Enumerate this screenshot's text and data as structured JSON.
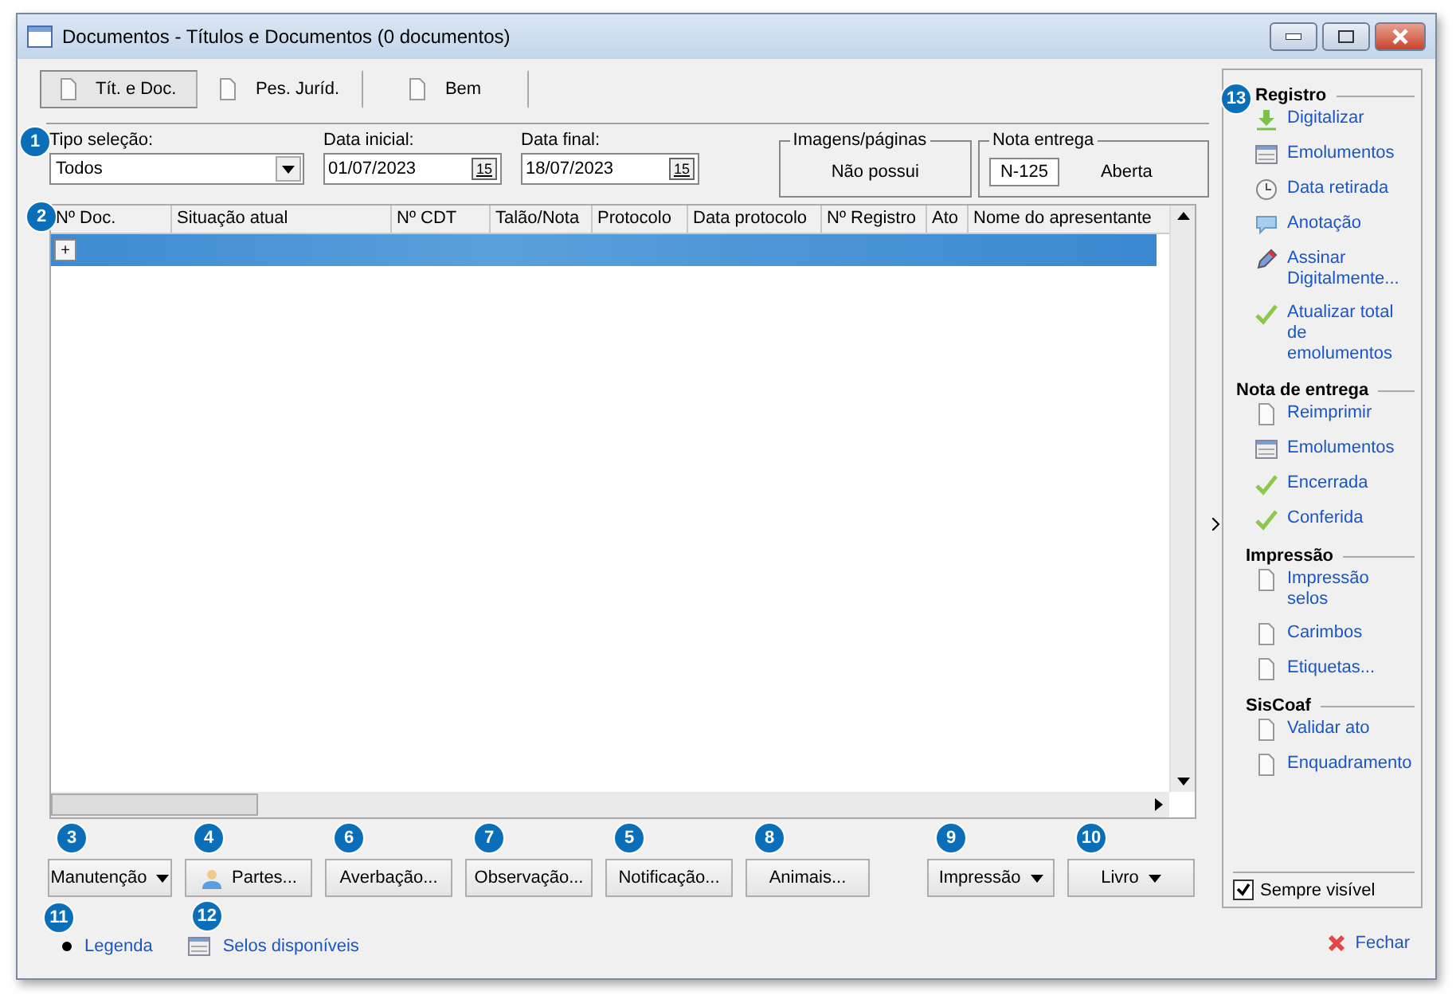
{
  "window": {
    "title": "Documentos - Títulos e Documentos (0 documentos)"
  },
  "tabs": [
    {
      "label": "Tít. e Doc.",
      "selected": true
    },
    {
      "label": "Pes. Juríd.",
      "selected": false
    },
    {
      "label": "Bem",
      "selected": false
    }
  ],
  "filters": {
    "callout": "1",
    "tipo_selecao": {
      "label": "Tipo seleção:",
      "value": "Todos"
    },
    "data_inicial": {
      "label": "Data inicial:",
      "value": "01/07/2023",
      "calendar_glyph": "15"
    },
    "data_final": {
      "label": "Data final:",
      "value": "18/07/2023",
      "calendar_glyph": "15"
    }
  },
  "imagens": {
    "title": "Imagens/páginas",
    "value": "Não possui"
  },
  "nota_entrega": {
    "title": "Nota entrega",
    "number": "N-125",
    "status": "Aberta"
  },
  "table": {
    "callout": "2",
    "expand_glyph": "+",
    "columns": [
      "Nº Doc.",
      "Situação atual",
      "Nº CDT",
      "Talão/Nota",
      "Protocolo",
      "Data protocolo",
      "Nº Registro",
      "Ato",
      "Nome do apresentante"
    ],
    "rows": [
      {
        "selected": true
      }
    ]
  },
  "buttons": [
    {
      "label": "Manutenção",
      "callout": "3",
      "kind": "dropdown"
    },
    {
      "label": "Partes...",
      "callout": "4",
      "kind": "person"
    },
    {
      "label": "Averbação...",
      "callout": "6",
      "kind": "plain"
    },
    {
      "label": "Observação...",
      "callout": "7",
      "kind": "plain"
    },
    {
      "label": "Notificação...",
      "callout": "5",
      "kind": "plain"
    },
    {
      "label": "Animais...",
      "callout": "8",
      "kind": "plain"
    },
    {
      "label": "Impressão",
      "callout": "9",
      "kind": "dropdown"
    },
    {
      "label": "Livro",
      "callout": "10",
      "kind": "dropdown"
    }
  ],
  "footer_links": [
    {
      "label": "Legenda",
      "callout": "11",
      "kind": "dot"
    },
    {
      "label": "Selos disponíveis",
      "callout": "12",
      "kind": "list"
    }
  ],
  "sidebar": {
    "sections": [
      {
        "title": "Registro",
        "callout": "13",
        "items": [
          {
            "label": "Digitalizar",
            "kind": "download"
          },
          {
            "label": "Emolumentos",
            "kind": "list"
          },
          {
            "label": "Data retirada",
            "kind": "clock"
          },
          {
            "label": "Anotação",
            "kind": "bubble"
          },
          {
            "label": "Assinar Digitalmente...",
            "kind": "pen"
          },
          {
            "label": "Atualizar total de emolumentos",
            "kind": "check"
          }
        ]
      },
      {
        "title": "Nota de entrega",
        "items": [
          {
            "label": "Reimprimir",
            "kind": "page"
          },
          {
            "label": "Emolumentos",
            "kind": "list"
          },
          {
            "label": "Encerrada",
            "kind": "check"
          },
          {
            "label": "Conferida",
            "kind": "check"
          }
        ]
      },
      {
        "title": "Impressão",
        "items": [
          {
            "label": "Impressão selos",
            "kind": "page"
          },
          {
            "label": "Carimbos",
            "kind": "page"
          },
          {
            "label": "Etiquetas...",
            "kind": "page"
          }
        ]
      },
      {
        "title": "SisCoaf",
        "items": [
          {
            "label": "Validar ato",
            "kind": "page"
          },
          {
            "label": "Enquadramento",
            "kind": "page"
          }
        ]
      }
    ],
    "always_visible": {
      "label": "Sempre visível",
      "checked": true
    }
  },
  "close_link": {
    "label": "Fechar"
  }
}
